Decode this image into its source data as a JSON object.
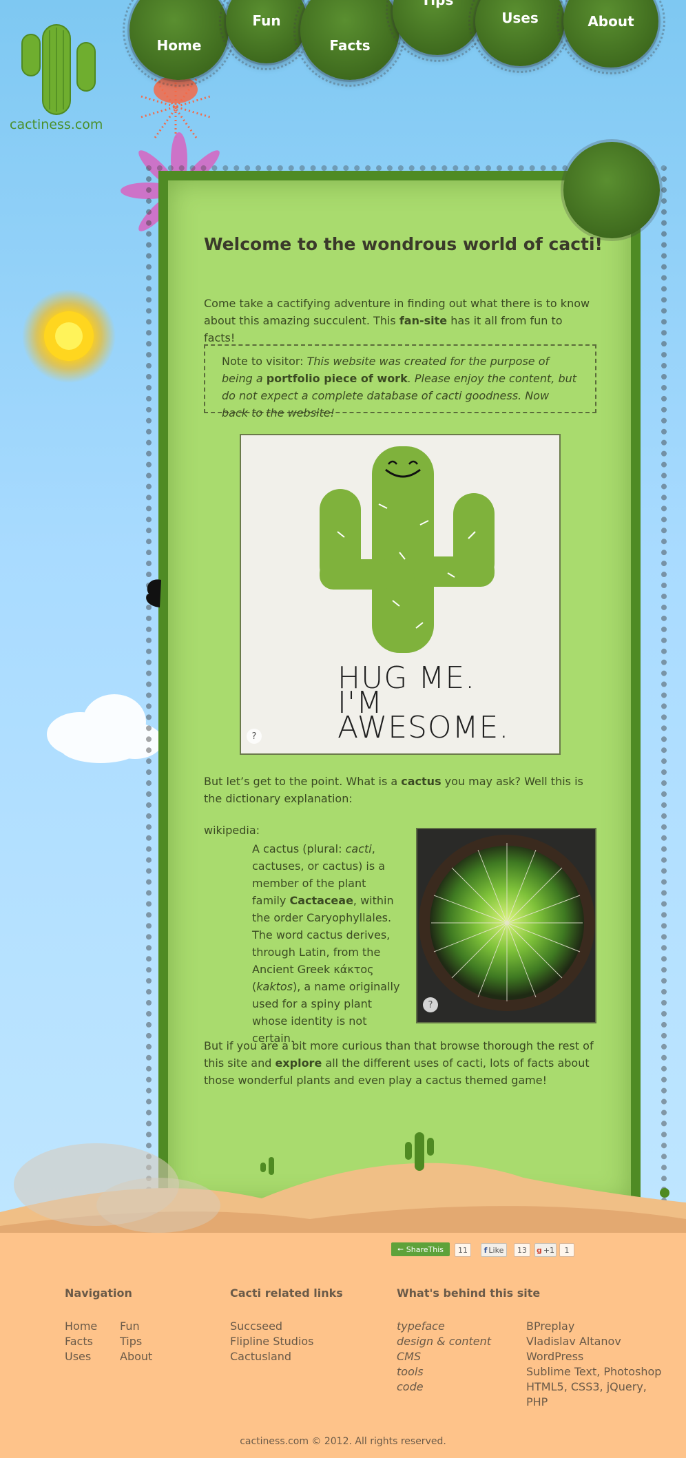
{
  "site": {
    "logo_text": "cactiness.com"
  },
  "nav": {
    "items": [
      {
        "label": "Home"
      },
      {
        "label": "Fun"
      },
      {
        "label": "Facts"
      },
      {
        "label": "Tips"
      },
      {
        "label": "Uses"
      },
      {
        "label": "About"
      }
    ]
  },
  "main": {
    "title": "Welcome to the wondrous world of cacti!",
    "intro_before": "Come take a cactifying adventure in finding out what there is to know about this amazing succulent. This ",
    "intro_bold": "fan-site",
    "intro_after": " has it all from fun to facts!",
    "note_label": "Note to visitor: ",
    "note_italic_1": "This website was created for the purpose of being a ",
    "note_bold": "portfolio piece of work",
    "note_italic_2": ". Please enjoy the content, but do not expect a complete database of cacti goodness. Now back to the website!",
    "poster_line1": "HUG ME.",
    "poster_line2": "I'M",
    "poster_line3": "AWESOME.",
    "help_label": "?",
    "point_before": "But let’s get to the point. What is a ",
    "point_bold": "cactus",
    "point_after": " you may ask? Well this is the dictionary explanation:",
    "wiki_label": "wikipedia:",
    "wiki_1": "A cactus (plural: ",
    "wiki_cacti": "cacti",
    "wiki_2": ", cactuses, or cactus) is a member of the plant family ",
    "wiki_family": "Cactaceae",
    "wiki_3": ", within the order Caryophyllales. The word cactus derives, through Latin, from the Ancient Greek κάκτος (",
    "wiki_kaktos": "kaktos",
    "wiki_4": "), a name originally used for a spiny plant whose identity is not certain.",
    "curious_before": "But if you are a bit more curious than that browse thorough the rest of this site and ",
    "curious_bold": "explore",
    "curious_after": " all the different uses of cacti, lots of facts about those wonderful plants and even play a cactus themed game!"
  },
  "share": {
    "sharethis_label": "ShareThis",
    "sharethis_count": "11",
    "fb_label": "Like",
    "fb_count": "13",
    "gplus_label": "+1",
    "gplus_count": "1"
  },
  "footer": {
    "navigation_title": "Navigation",
    "navigation_links": [
      "Home",
      "Fun",
      "Facts",
      "Tips",
      "Uses",
      "About"
    ],
    "links_title": "Cacti related links",
    "related_links": [
      "Succseed",
      "Flipline Studios",
      "Cactusland"
    ],
    "behind_title": "What's behind this site",
    "behind_items": [
      {
        "label": "typeface",
        "value": "BPreplay"
      },
      {
        "label": "design & content",
        "value": "Vladislav Altanov"
      },
      {
        "label": "CMS",
        "value": "WordPress"
      },
      {
        "label": "tools",
        "value": "Sublime Text, Photoshop"
      },
      {
        "label": "code",
        "value": "HTML5, CSS3, jQuery, PHP"
      }
    ],
    "copyright": "cactiness.com © 2012. All rights reserved."
  },
  "colors": {
    "sky": "#a9dbff",
    "panel": "#a9db6e",
    "panel_border": "#4f8b24",
    "nav_bubble": "#4a7a25",
    "footer": "#fec38a",
    "sand": "#e8b27a"
  }
}
